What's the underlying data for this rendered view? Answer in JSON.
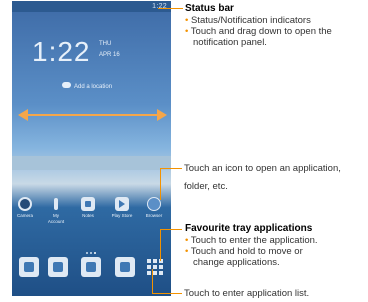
{
  "phone": {
    "status": "1:22",
    "clock": "1:22",
    "day": "THU",
    "date": "APR 16",
    "add_location": "Add a location",
    "apps": [
      {
        "label": "Camera",
        "icon": "camera-icon"
      },
      {
        "label": "My Account",
        "icon": "account-icon"
      },
      {
        "label": "Notes",
        "icon": "notes-icon"
      },
      {
        "label": "Play Store",
        "icon": "play-store-icon"
      },
      {
        "label": "Browser",
        "icon": "browser-icon"
      }
    ],
    "tray": [
      "phone-icon",
      "contacts-icon",
      "messages-icon",
      "email-icon",
      "app-list-icon"
    ],
    "accent": "#f5a64a"
  },
  "callouts": {
    "status_bar": {
      "title": "Status bar",
      "bullets": [
        "Status/Notification indicators",
        "Touch and drag down to open the",
        "notification panel."
      ]
    },
    "open_app": {
      "line1": "Touch an icon to open an application,",
      "line2": "folder, etc."
    },
    "favourite_tray": {
      "title": "Favourite tray applications",
      "bullets": [
        "Touch to enter the application.",
        "Touch and hold to move or",
        "change applications."
      ]
    },
    "app_list": {
      "text": "Touch to enter application list."
    },
    "line_color": "#f39200"
  }
}
